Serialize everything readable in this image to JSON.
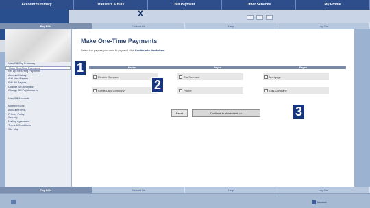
{
  "top_nav": [
    {
      "label": "Account Summary"
    },
    {
      "label": "Transfers & Bills"
    },
    {
      "label": "Bill Payment"
    },
    {
      "label": "Other Services"
    },
    {
      "label": "My Profile"
    }
  ],
  "window": {
    "close_label": "X"
  },
  "tabs": [
    {
      "label": "Pay Bills",
      "active": true
    },
    {
      "label": "Contact Us",
      "active": false
    },
    {
      "label": "Help",
      "active": false
    },
    {
      "label": "Log Out",
      "active": false
    }
  ],
  "sidebar": {
    "items": [
      {
        "label": "View Bill Pay Summary",
        "selected": false
      },
      {
        "label": "Make One-Time Payments",
        "selected": true
      },
      {
        "label": "Set Up Recurring Payments",
        "selected": false
      },
      {
        "label": "Account History",
        "selected": false
      },
      {
        "label": "Add New Payees",
        "selected": false
      },
      {
        "label": "Edit Bill Payees",
        "selected": false
      },
      {
        "label": "Change Bill Reception",
        "selected": false
      },
      {
        "label": "Change Bill Pay Accounts",
        "selected": false
      }
    ],
    "items_b": [
      {
        "label": "View Bill Accounts"
      }
    ],
    "items_c": [
      {
        "label": "Meeting Tools"
      },
      {
        "label": "Account Forms"
      },
      {
        "label": "Privacy Policy"
      },
      {
        "label": "Security"
      },
      {
        "label": "Mailing Agreement"
      },
      {
        "label": "Terms & Conditions"
      },
      {
        "label": "Site Map"
      }
    ]
  },
  "main": {
    "title": "Make One-Time Payments",
    "instruction": "Select the payees you want to pay and click",
    "instruction_link": "Continue to Worksheet"
  },
  "table": {
    "headers": [
      "Payee",
      "Payee",
      "Payee"
    ],
    "options": [
      [
        "Electric Company",
        "Credit Card Company"
      ],
      [
        "Car Payment",
        "Phone"
      ],
      [
        "Mortgage",
        "Gas Company"
      ]
    ]
  },
  "buttons": {
    "reset": "Reset",
    "continue": "Continue to Worksheet >>"
  },
  "callouts": [
    "1",
    "2",
    "3"
  ],
  "bottom_tabs": [
    {
      "label": "Pay Bills",
      "active": true
    },
    {
      "label": "Contact Us",
      "active": false
    },
    {
      "label": "Help",
      "active": false
    },
    {
      "label": "Log Out",
      "active": false
    }
  ],
  "status": {
    "zone": "Internet"
  }
}
